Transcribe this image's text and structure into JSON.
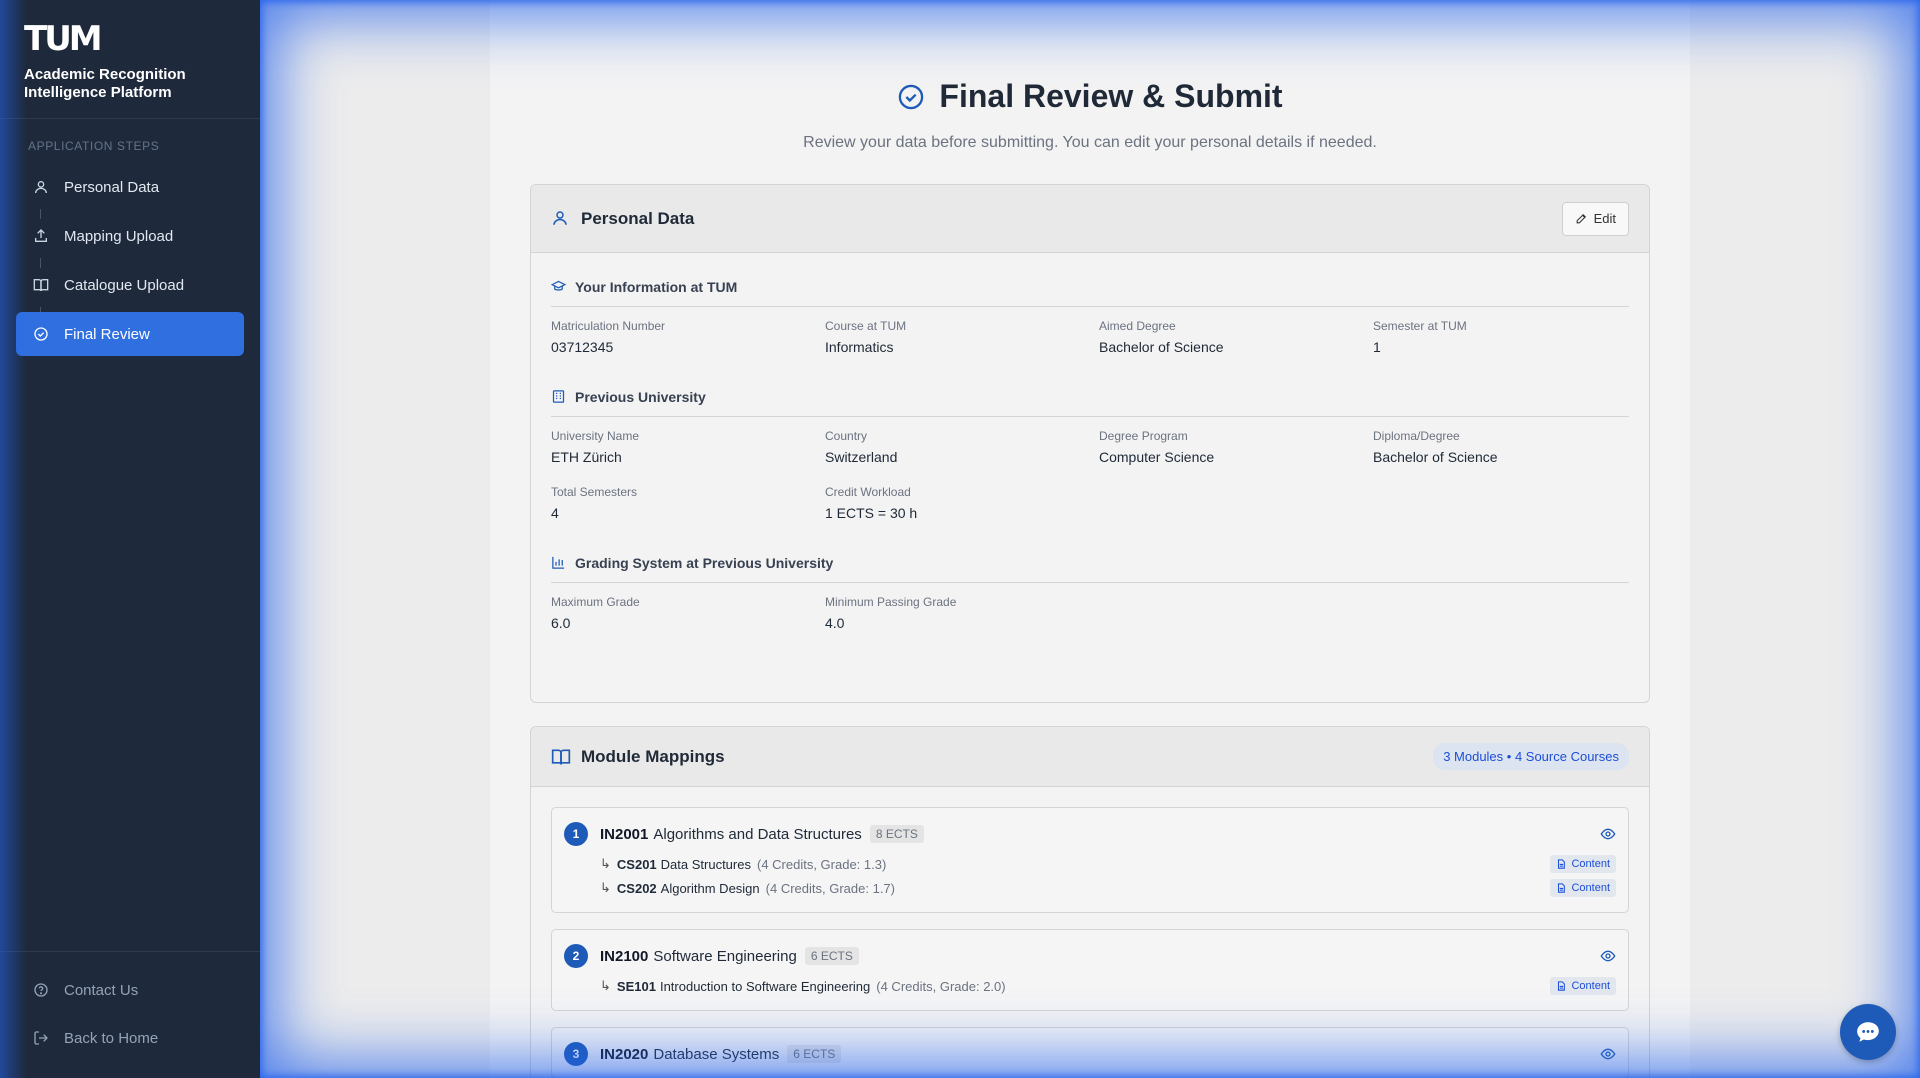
{
  "sidebar": {
    "logo": "TUM",
    "brand_name": "Academic Recognition Intelligence Platform",
    "section_label": "APPLICATION STEPS",
    "steps": [
      {
        "label": "Personal Data",
        "icon": "user-icon"
      },
      {
        "label": "Mapping Upload",
        "icon": "upload-icon"
      },
      {
        "label": "Catalogue Upload",
        "icon": "book-icon"
      },
      {
        "label": "Final Review",
        "icon": "check-circle-icon",
        "active": true
      }
    ],
    "bottom": [
      {
        "label": "Contact Us",
        "icon": "help-circle-icon"
      },
      {
        "label": "Back to Home",
        "icon": "logout-icon"
      }
    ]
  },
  "page": {
    "title": "Final Review & Submit",
    "subtitle": "Review your data before submitting. You can edit your personal details if needed."
  },
  "personal": {
    "title": "Personal Data",
    "edit_label": "Edit",
    "tum": {
      "title": "Your Information at TUM",
      "fields": [
        {
          "label": "Matriculation Number",
          "value": "03712345"
        },
        {
          "label": "Course at TUM",
          "value": "Informatics"
        },
        {
          "label": "Aimed Degree",
          "value": "Bachelor of Science"
        },
        {
          "label": "Semester at TUM",
          "value": "1"
        }
      ]
    },
    "prev": {
      "title": "Previous University",
      "fields": [
        {
          "label": "University Name",
          "value": "ETH Zürich"
        },
        {
          "label": "Country",
          "value": "Switzerland"
        },
        {
          "label": "Degree Program",
          "value": "Computer Science"
        },
        {
          "label": "Diploma/Degree",
          "value": "Bachelor of Science"
        },
        {
          "label": "Total Semesters",
          "value": "4"
        },
        {
          "label": "Credit Workload",
          "value": "1 ECTS = 30 h"
        }
      ]
    },
    "grading": {
      "title": "Grading System at Previous University",
      "fields": [
        {
          "label": "Maximum Grade",
          "value": "6.0"
        },
        {
          "label": "Minimum Passing Grade",
          "value": "4.0"
        }
      ]
    }
  },
  "mappings": {
    "title": "Module Mappings",
    "summary": "3 Modules • 4 Source Courses",
    "content_label": "Content",
    "modules": [
      {
        "num": "1",
        "code": "IN2001",
        "name": "Algorithms and Data Structures",
        "ects": "8 ECTS",
        "courses": [
          {
            "arrow": "↳",
            "code": "CS201",
            "name": "Data Structures",
            "details": "(4 Credits, Grade: 1.3)"
          },
          {
            "arrow": "↳",
            "code": "CS202",
            "name": "Algorithm Design",
            "details": "(4 Credits, Grade: 1.7)"
          }
        ]
      },
      {
        "num": "2",
        "code": "IN2100",
        "name": "Software Engineering",
        "ects": "6 ECTS",
        "courses": [
          {
            "arrow": "↳",
            "code": "SE101",
            "name": "Introduction to Software Engineering",
            "details": "(4 Credits, Grade: 2.0)"
          }
        ]
      },
      {
        "num": "3",
        "code": "IN2020",
        "name": "Database Systems",
        "ects": "6 ECTS",
        "courses": []
      }
    ]
  },
  "colors": {
    "sidebar_bg": "#1e293b",
    "accent": "#2f6fe0",
    "badge_blue": "#1e5bb8"
  }
}
